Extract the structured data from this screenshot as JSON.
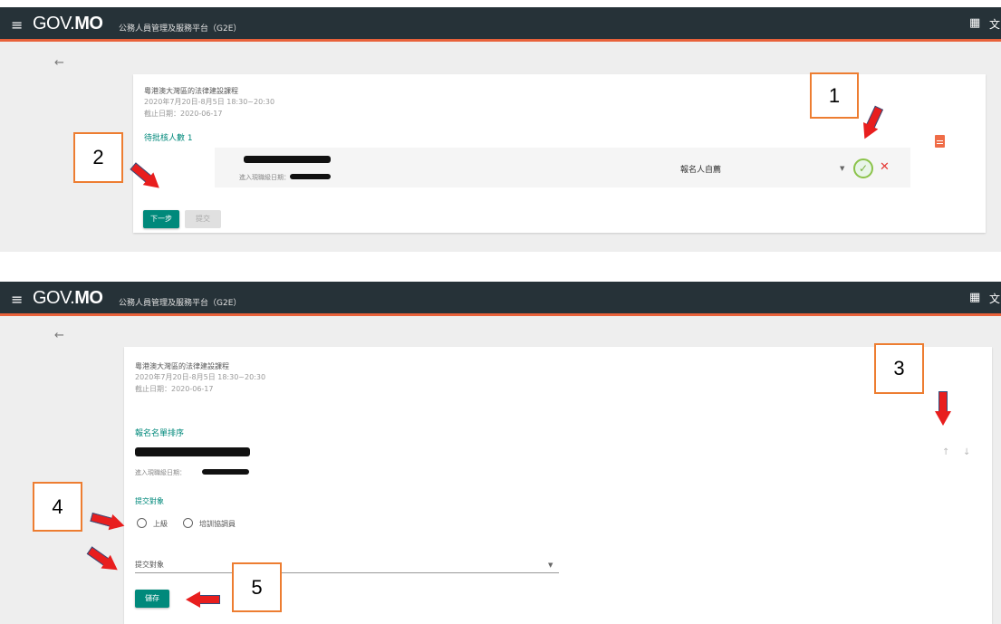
{
  "appbar": {
    "menu_icon": "menu-icon",
    "brand_gov": "GOV.",
    "brand_mo": "MO",
    "platform": "公務人員管理及服務平台（G2E）",
    "apps_icon": "grid-icon",
    "lang_label": "文"
  },
  "back_icon": "←",
  "course": {
    "title": "粵港澳大灣區的法律建設課程",
    "date": "2020年7月20日-8月5日 18:30~20:30",
    "deadline": "截止日期：2020-06-17"
  },
  "top_panel": {
    "pending_label": "待批核人數 1",
    "entry_date_label": "進入現職級日期：",
    "select_value": "報名人自薦",
    "next_button": "下一步",
    "submit_button": "提交"
  },
  "bottom_panel": {
    "sort_title": "報名名單排序",
    "entry_date_label": "進入現職級日期：",
    "submit_target_title": "提交對象",
    "radio_options": [
      "上級",
      "培訓協調員"
    ],
    "dropdown_placeholder": "提交對象",
    "save_button": "儲存"
  },
  "callouts": [
    "1",
    "2",
    "3",
    "4",
    "5"
  ],
  "colors": {
    "appbar": "#263238",
    "accent_line": "#e8613a",
    "primary": "#00897b",
    "callout_border": "#ed7d31",
    "arrow_red": "#e81e1e"
  }
}
